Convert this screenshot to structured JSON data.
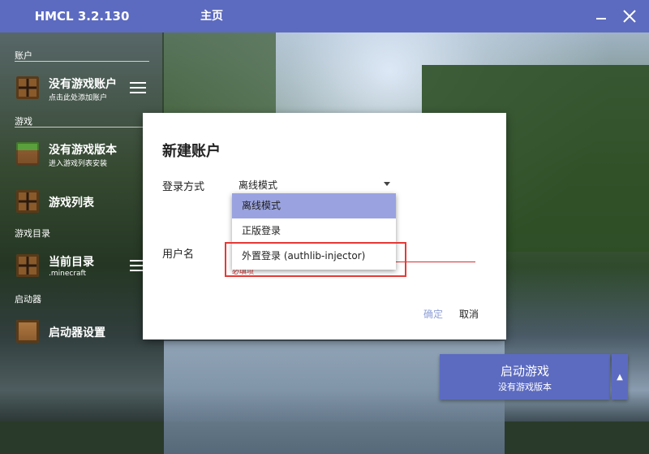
{
  "app": {
    "title": "HMCL 3.2.130",
    "page_title": "主页"
  },
  "window_controls": {
    "minimize_icon": "minimize-icon",
    "close_icon": "close-icon"
  },
  "sidebar": {
    "sections": [
      {
        "title": "账户"
      },
      {
        "title": "游戏"
      },
      {
        "title": "游戏目录"
      },
      {
        "title": "启动器"
      }
    ],
    "account": {
      "title": "没有游戏账户",
      "subtitle": "点击此处添加账户"
    },
    "game_version": {
      "title": "没有游戏版本",
      "subtitle": "进入游戏列表安装"
    },
    "game_list": {
      "title": "游戏列表"
    },
    "current_dir": {
      "title": "当前目录",
      "subtitle": ".minecraft"
    },
    "launcher_settings": {
      "title": "启动器设置"
    }
  },
  "launch": {
    "title": "启动游戏",
    "subtitle": "没有游戏版本",
    "arrow": "▲"
  },
  "dialog": {
    "title": "新建账户",
    "login_method_label": "登录方式",
    "login_method_value": "离线模式",
    "username_label": "用户名",
    "username_error": "必填项",
    "ok_label": "确定",
    "cancel_label": "取消"
  },
  "dropdown": {
    "options": [
      "离线模式",
      "正版登录",
      "外置登录 (authlib-injector)"
    ],
    "selected_index": 0
  },
  "colors": {
    "accent": "#5c6bc0",
    "error": "#d32f2f",
    "highlight_box": "#e53935"
  }
}
